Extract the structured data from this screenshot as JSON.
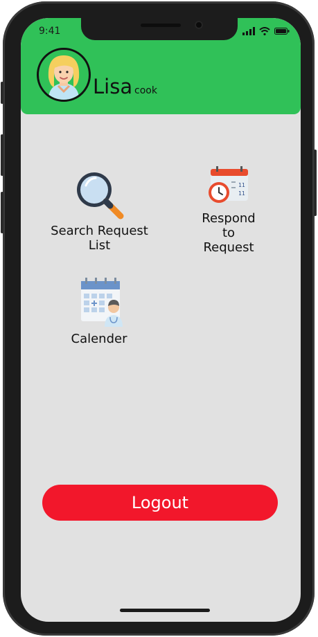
{
  "status_bar": {
    "time": "9:41"
  },
  "profile": {
    "name": "Lisa",
    "role": "cook"
  },
  "menu": [
    {
      "label": "Search Request List",
      "icon": "magnifier-icon"
    },
    {
      "label_lines": [
        "Respond",
        "to",
        "Request"
      ],
      "icon": "calendar-clock-icon"
    },
    {
      "label": "Calender",
      "icon": "calendar-doctor-icon"
    }
  ],
  "logout": {
    "label": "Logout"
  },
  "colors": {
    "header": "#30c158",
    "logout": "#f2172b",
    "background": "#e1e1e1"
  }
}
